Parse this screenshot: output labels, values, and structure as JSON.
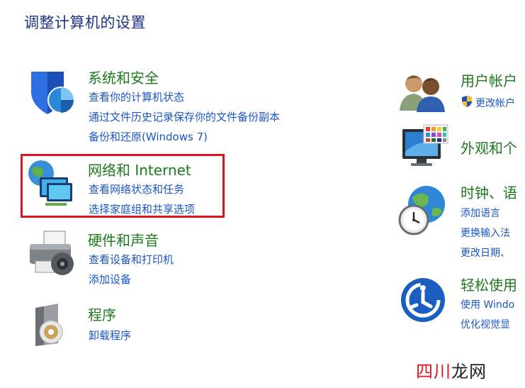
{
  "page_title": "调整计算机的设置",
  "left_categories": [
    {
      "title": "系统和安全",
      "icon": "shield-icon",
      "links": [
        "查看你的计算机状态",
        "通过文件历史记录保存你的文件备份副本",
        "备份和还原(Windows 7)"
      ]
    },
    {
      "title": "网络和 Internet",
      "icon": "network-icon",
      "links": [
        "查看网络状态和任务",
        "选择家庭组和共享选项"
      ]
    },
    {
      "title": "硬件和声音",
      "icon": "printer-icon",
      "links": [
        "查看设备和打印机",
        "添加设备"
      ]
    },
    {
      "title": "程序",
      "icon": "programs-icon",
      "links": [
        "卸载程序"
      ]
    }
  ],
  "right_categories": [
    {
      "title": "用户帐户",
      "icon": "users-icon",
      "links": [
        "更改帐户"
      ]
    },
    {
      "title": "外观和个",
      "icon": "appearance-icon",
      "links": []
    },
    {
      "title": "时钟、语",
      "icon": "clock-globe-icon",
      "links": [
        "添加语言",
        "更换输入法",
        "更改日期、"
      ]
    },
    {
      "title": "轻松使用",
      "icon": "ease-of-access-icon",
      "links": [
        "使用 Windo",
        "优化视觉显"
      ]
    }
  ],
  "watermark": {
    "part1": "四川",
    "part2": "龙网"
  },
  "colors": {
    "category_title": "#1e7a1e",
    "link": "#1a56c8",
    "page_title": "#1e3287",
    "highlight": "#e0141e"
  }
}
